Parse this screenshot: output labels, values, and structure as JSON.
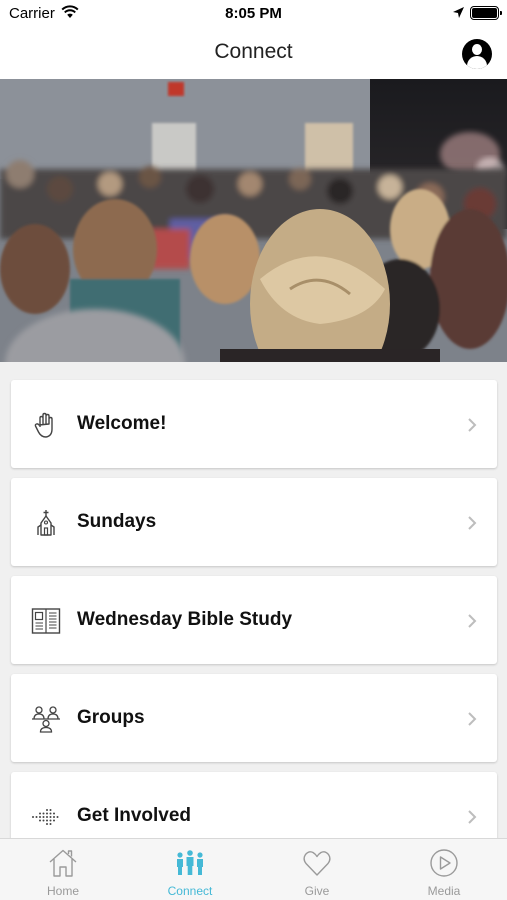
{
  "status_bar": {
    "carrier": "Carrier",
    "time": "8:05 PM"
  },
  "nav": {
    "title": "Connect"
  },
  "hero": {
    "icon": "congregation-photo"
  },
  "items": [
    {
      "label": "Welcome!",
      "icon": "hand-wave-icon"
    },
    {
      "label": "Sundays",
      "icon": "church-icon"
    },
    {
      "label": "Wednesday Bible Study",
      "icon": "open-book-icon"
    },
    {
      "label": "Groups",
      "icon": "group-people-icon"
    },
    {
      "label": "Get Involved",
      "icon": "dots-arrow-icon"
    }
  ],
  "tabs": [
    {
      "label": "Home",
      "icon": "house-icon",
      "active": false
    },
    {
      "label": "Connect",
      "icon": "people-icon",
      "active": true
    },
    {
      "label": "Give",
      "icon": "heart-icon",
      "active": false
    },
    {
      "label": "Media",
      "icon": "play-circle-icon",
      "active": false
    }
  ],
  "colors": {
    "accent": "#45b9d6",
    "tab_inactive": "#9a9a9a",
    "background": "#f0f0f0"
  }
}
